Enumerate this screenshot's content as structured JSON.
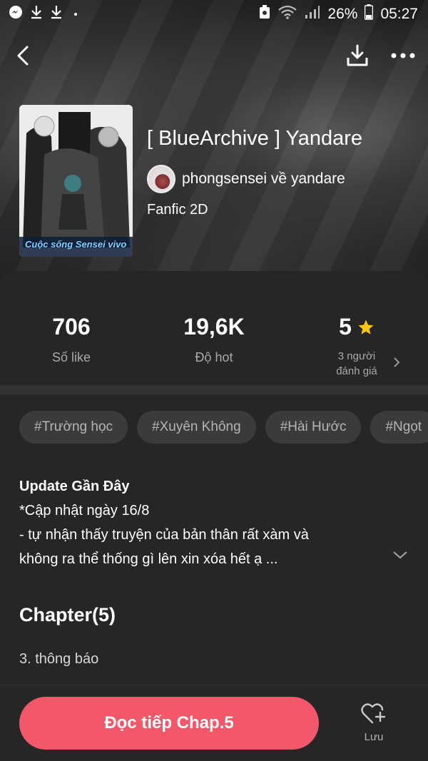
{
  "status_bar": {
    "battery": "26%",
    "time": "05:27"
  },
  "book": {
    "title": "[ BlueArchive ] Yandare",
    "author": "phongsensei về yandare",
    "genre": "Fanfic 2D",
    "cover_caption": "Cuộc sống Sensei vivo"
  },
  "stats": {
    "likes_value": "706",
    "likes_label": "Số like",
    "hot_value": "19,6K",
    "hot_label": "Độ hot",
    "rating_value": "5",
    "rating_label": "3 người đánh giá"
  },
  "tags": [
    "#Trường học",
    "#Xuyên Không",
    "#Hài Hước",
    "#Ngọt"
  ],
  "update": {
    "title": "Update Gần Đây",
    "line1": "*Cập nhật ngày 16/8",
    "line2": "- tự nhận thấy truyện của bản thân rất xàm và",
    "line3": "không ra thể thống gì lên xin xóa hết ạ ..."
  },
  "chapters": {
    "title": "Chapter(5)",
    "items": [
      "3. thông báo"
    ]
  },
  "bottom": {
    "read_label": "Đọc tiếp Chap.5",
    "save_label": "Lưu"
  },
  "colors": {
    "accent": "#f2576a",
    "star": "#f5c518",
    "background": "#262626"
  }
}
